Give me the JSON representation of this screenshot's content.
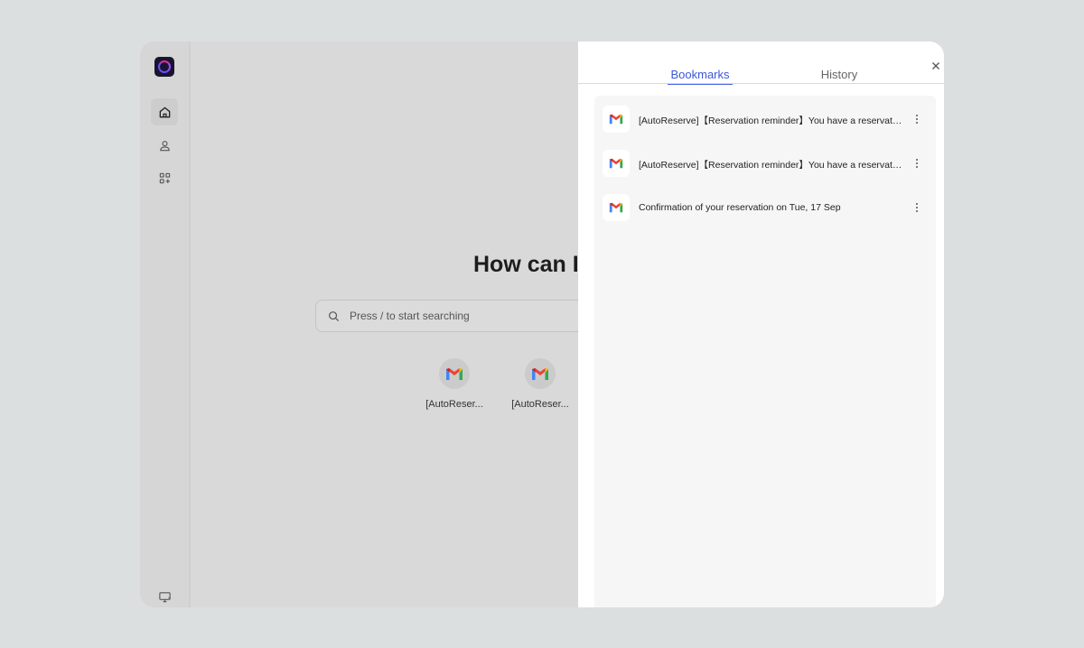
{
  "main": {
    "headline": "How can I help",
    "search": {
      "placeholder": "Press / to start searching"
    },
    "shortcuts": [
      {
        "label": "[AutoReser...",
        "icon": "gmail-icon"
      },
      {
        "label": "[AutoReser...",
        "icon": "gmail-icon"
      }
    ]
  },
  "sidebar": {
    "items": [
      {
        "icon": "home-icon",
        "active": true
      },
      {
        "icon": "user-icon",
        "active": false
      },
      {
        "icon": "apps-add-icon",
        "active": false
      },
      {
        "icon": "monitor-icon",
        "active": false
      }
    ]
  },
  "panel": {
    "tabs": [
      {
        "label": "Bookmarks",
        "active": true
      },
      {
        "label": "History",
        "active": false
      }
    ],
    "bookmarks": [
      {
        "title": "[AutoReserve]【Reservation reminder】You have a reservation...",
        "icon": "gmail-icon"
      },
      {
        "title": "[AutoReserve]【Reservation reminder】You have a reservation...",
        "icon": "gmail-icon"
      },
      {
        "title": "Confirmation of your reservation on Tue, 17 Sep",
        "icon": "gmail-icon"
      }
    ]
  },
  "colors": {
    "accent": "#4a63e0",
    "background": "#dcdfdf",
    "panel": "#ffffff"
  }
}
